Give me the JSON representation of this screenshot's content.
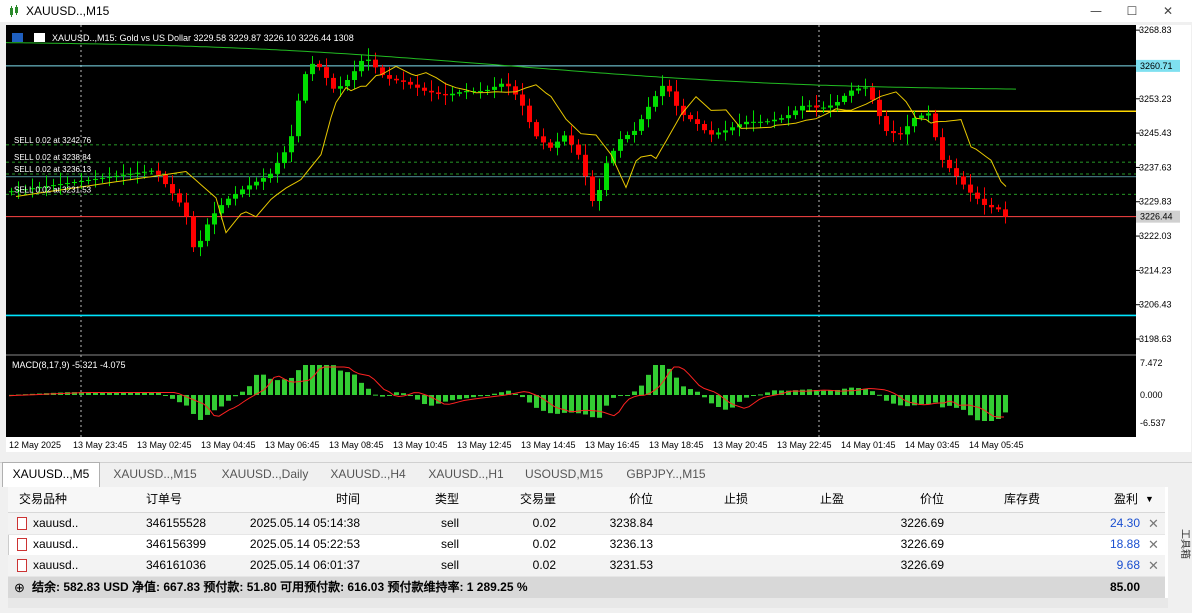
{
  "window": {
    "title": "XAUUSD..,M15",
    "buttons": {
      "minimize": "—",
      "maximize": "☐",
      "close": "✕"
    }
  },
  "chart": {
    "info_line": "XAUUSD..,M15:  Gold vs US Dollar  3229.58 3229.87 3226.10 3226.44  1308",
    "macd_label": "MACD(8,17,9) -5.321 -4.075",
    "price_labels": [
      "3268.83",
      "3253.23",
      "3245.43",
      "3237.63",
      "3229.83",
      "3222.03",
      "3214.23",
      "3206.43",
      "3198.63"
    ],
    "highlight_labels": {
      "cyan": "3260.71",
      "current": "3226.44"
    },
    "macd_labels": [
      "7.472",
      "0.000",
      "-6.537"
    ],
    "time_labels": [
      "12 May 2025",
      "13 May 23:45",
      "13 May 02:45",
      "13 May 04:45",
      "13 May 06:45",
      "13 May 08:45",
      "13 May 10:45",
      "13 May 12:45",
      "13 May 14:45",
      "13 May 16:45",
      "13 May 18:45",
      "13 May 20:45",
      "13 May 22:45",
      "14 May 01:45",
      "14 May 03:45",
      "14 May 05:45"
    ],
    "orders": [
      {
        "label": "SELL 0.02 at 3242.76",
        "price": 3242.76
      },
      {
        "label": "SELL 0.02 at 3238.84",
        "price": 3238.84
      },
      {
        "label": "SELL 0.02 at 3236.13",
        "price": 3236.13
      },
      {
        "label": "SELL 0.02 at 3231.53",
        "price": 3231.53
      }
    ],
    "levels": {
      "cyan_top": 3260.71,
      "cyan_mid": 3235.5,
      "cyan_low": 3204.0,
      "yellow": 3250.4,
      "current": 3226.44
    },
    "price_range": [
      3195.0,
      3270.0
    ],
    "colors": {
      "bull": "#00dd00",
      "bear": "#ff0000",
      "grid": "#555555",
      "cyan": "#00bfff",
      "yellow": "#ffd700",
      "macd_bar": "#33cc33",
      "macd_signal": "#ff2222"
    }
  },
  "tabs": [
    "XAUUSD..,M5",
    "XAUUSD..,M15",
    "XAUUSD..,Daily",
    "XAUUSD..,H4",
    "XAUUSD..,H1",
    "USOUSD,M15",
    "GBPJPY..,M15"
  ],
  "active_tab": 0,
  "table": {
    "headers": [
      "交易品种",
      "订单号",
      "时间",
      "类型",
      "交易量",
      "价位",
      "止损",
      "止盈",
      "价位",
      "库存费",
      "盈利"
    ],
    "sort_icon": "▼",
    "rows": [
      {
        "symbol": "xauusd..",
        "order": "346155528",
        "time": "2025.05.14 05:14:38",
        "type": "sell",
        "volume": "0.02",
        "price": "3238.84",
        "sl": "",
        "tp": "",
        "current": "3226.69",
        "swap": "",
        "profit": "24.30"
      },
      {
        "symbol": "xauusd..",
        "order": "346156399",
        "time": "2025.05.14 05:22:53",
        "type": "sell",
        "volume": "0.02",
        "price": "3236.13",
        "sl": "",
        "tp": "",
        "current": "3226.69",
        "swap": "",
        "profit": "18.88"
      },
      {
        "symbol": "xauusd..",
        "order": "346161036",
        "time": "2025.05.14 06:01:37",
        "type": "sell",
        "volume": "0.02",
        "price": "3231.53",
        "sl": "",
        "tp": "",
        "current": "3226.69",
        "swap": "",
        "profit": "9.68"
      }
    ],
    "summary": "结余: 582.83 USD  净值: 667.83  预付款: 51.80  可用预付款: 616.03  预付款维持率: 1 289.25 %",
    "summary_total": "85.00",
    "close_glyph": "✕"
  },
  "toolbox_label": "工具箱"
}
